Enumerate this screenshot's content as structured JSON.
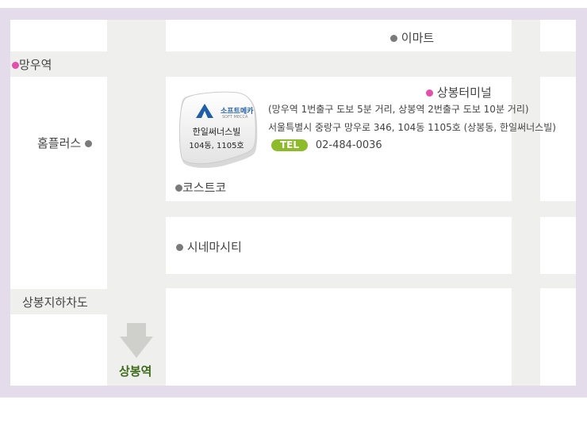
{
  "stations": {
    "mangu": "망우역",
    "sangbong_terminal": "상봉터미널",
    "sangbong_station": "상봉역",
    "underpass": "상봉지하차도"
  },
  "landmarks": {
    "emart": "이마트",
    "homeplus": "홈플러스",
    "costco": "코스트코",
    "cinema": "시네마시티"
  },
  "building": {
    "logo_name": "소프트메카",
    "logo_sub": "SOFT MECCA",
    "name": "한일써너스빌",
    "unit": "104동, 1105호"
  },
  "info": {
    "directions": "(망우역 1번출구 도보 5분 거리, 상봉역 2번출구 도보 10분 거리)",
    "address": "서울특별시 중랑구 망우로 346, 104동 1105호 (상봉동, 한일써너스빌)",
    "tel_label": "TEL",
    "tel": "02-484-0036"
  },
  "colors": {
    "frame": "#e4dcea",
    "road": "#efefed",
    "subway_dot": "#e34fae",
    "landmark_dot": "#7a7a7a",
    "tel_badge": "#8dbb2c",
    "station_text": "#3d6b1b"
  },
  "icons": {
    "arrow": "arrow-down-icon",
    "logo": "soft-mecca-logo-icon"
  }
}
